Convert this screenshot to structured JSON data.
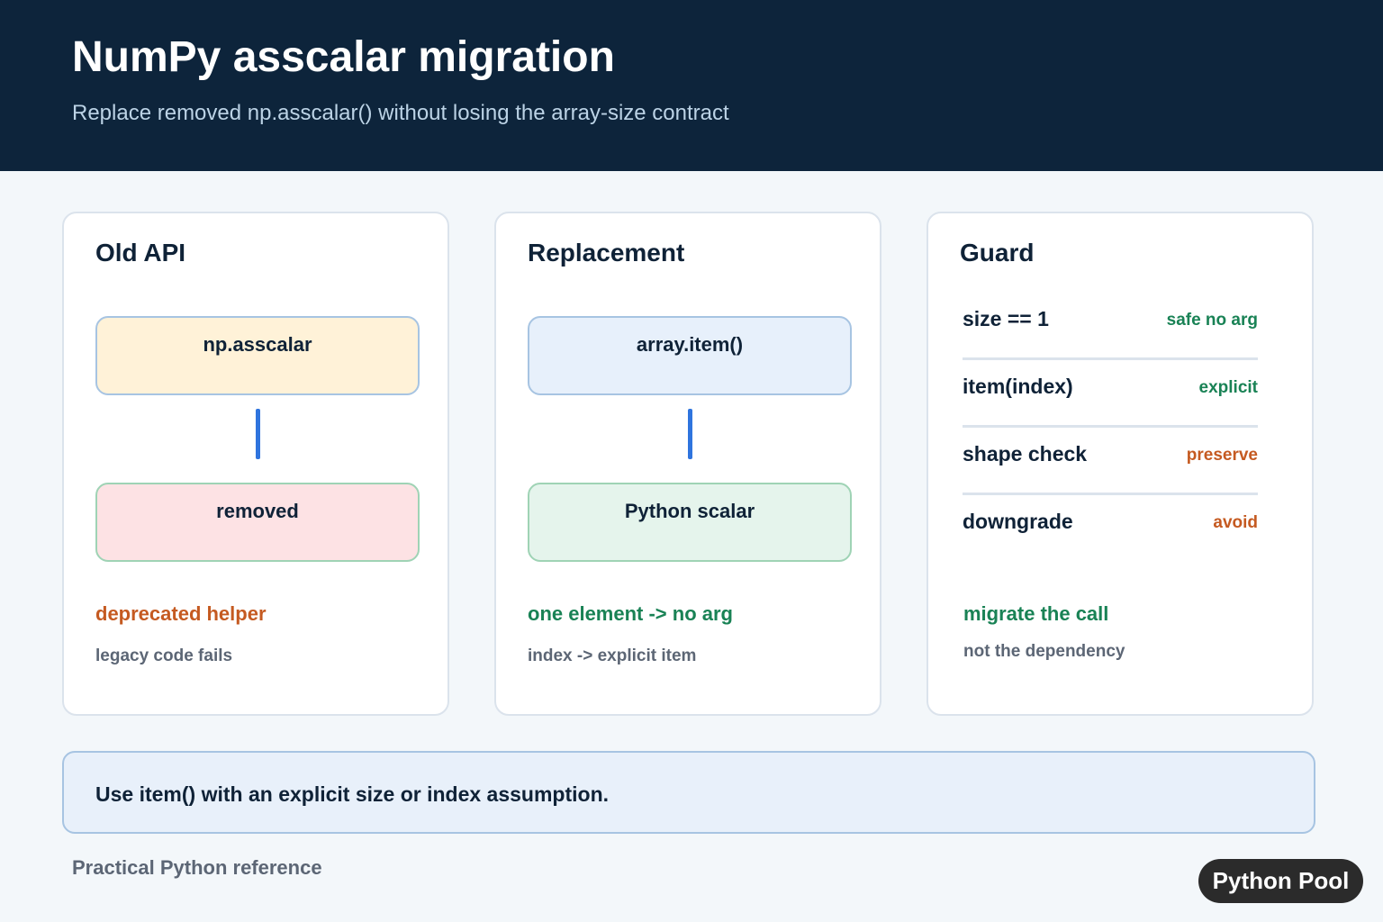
{
  "header": {
    "title": "NumPy asscalar migration",
    "subtitle": "Replace removed np.asscalar() without losing the array-size contract"
  },
  "cards": [
    {
      "title": "Old API",
      "top_box": "np.asscalar",
      "bottom_box": "removed",
      "note_main": "deprecated helper",
      "note_sub": "legacy code fails"
    },
    {
      "title": "Replacement",
      "top_box": "array.item()",
      "bottom_box": "Python scalar",
      "note_main": "one element -> no arg",
      "note_sub": "index -> explicit item"
    }
  ],
  "guard": {
    "title": "Guard",
    "rows": [
      {
        "label": "size == 1",
        "status": "safe no arg"
      },
      {
        "label": "item(index)",
        "status": "explicit"
      },
      {
        "label": "shape check",
        "status": "preserve"
      },
      {
        "label": "downgrade",
        "status": "avoid"
      }
    ],
    "note_main": "migrate the call",
    "note_sub": "not the dependency"
  },
  "callout": "Use item() with an explicit size or index assumption.",
  "footer": "Practical Python reference",
  "brand": "Python Pool",
  "colors": {
    "header_bg": "#0d243b",
    "accent_blue": "#2f74de",
    "status_green": "#198255",
    "status_orange": "#c55a21",
    "old_box_fill": "#fff2d8",
    "removed_box_fill": "#fde2e4",
    "replacement_box_fill": "#e7f0fb",
    "scalar_box_fill": "#e5f4ec"
  }
}
